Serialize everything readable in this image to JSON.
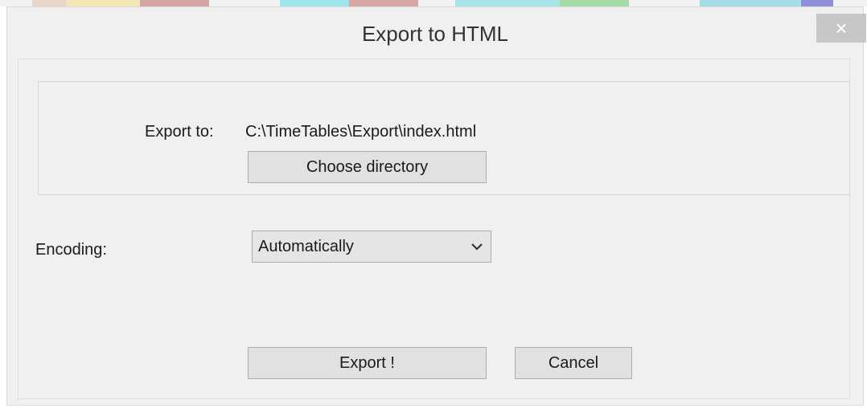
{
  "dialog": {
    "title": "Export to HTML",
    "close_glyph": "×"
  },
  "export_section": {
    "export_to_label": "Export to:",
    "export_path": "C:\\TimeTables\\Export\\index.html",
    "choose_directory_label": "Choose directory"
  },
  "encoding": {
    "label": "Encoding:",
    "selected": "Automatically",
    "icon": "chevron-down-icon"
  },
  "actions": {
    "export_label": "Export !",
    "cancel_label": "Cancel"
  },
  "colors": {
    "window_bg": "#f0f0f0",
    "close_button_bg": "#c7c7c7",
    "button_bg": "#e1e1e1",
    "button_border": "#adadad",
    "background_stripes": [
      "#e8d7c9",
      "#f3e7b8",
      "#d4a5a5",
      "#f2f2f2",
      "#9de5e8",
      "#d9a6a6",
      "#a8e3e8",
      "#a6dca8",
      "#f2f2f2",
      "#a4dde6",
      "#8f8fd9"
    ]
  }
}
